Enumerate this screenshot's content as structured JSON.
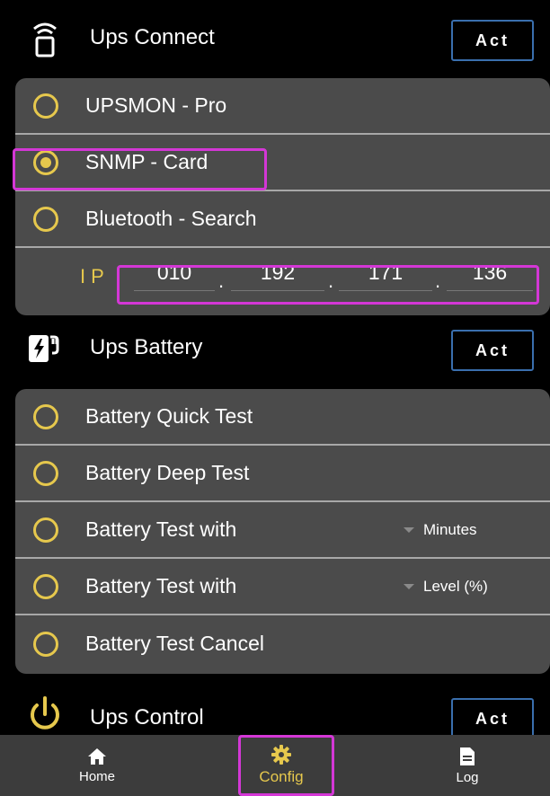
{
  "ups_connect": {
    "title": "Ups Connect",
    "act_label": "Act",
    "options": [
      {
        "label": "UPSMON - Pro",
        "checked": false
      },
      {
        "label": "SNMP - Card",
        "checked": true
      },
      {
        "label": "Bluetooth - Search",
        "checked": false
      }
    ],
    "ip": {
      "label": "IP",
      "octets": [
        "010",
        "192",
        "171",
        "136"
      ]
    }
  },
  "ups_battery": {
    "title": "Ups Battery",
    "act_label": "Act",
    "options": [
      {
        "label": "Battery Quick Test"
      },
      {
        "label": "Battery Deep Test"
      },
      {
        "label": "Battery Test with",
        "unit": "Minutes"
      },
      {
        "label": "Battery Test with",
        "unit": "Level (%)"
      },
      {
        "label": "Battery Test Cancel"
      }
    ]
  },
  "ups_control": {
    "title": "Ups Control",
    "act_label": "Act"
  },
  "nav": {
    "home": "Home",
    "config": "Config",
    "log": "Log"
  },
  "colors": {
    "accent": "#e6c84d",
    "highlight": "#d437d6",
    "button_border": "#3a6fae",
    "panel": "#4b4b4b"
  },
  "icons": {
    "ups_connect": "wireless-device-icon",
    "ups_battery": "battery-charge-icon",
    "ups_control": "power-icon",
    "home": "home-icon",
    "config": "gear-icon",
    "log": "document-icon"
  }
}
